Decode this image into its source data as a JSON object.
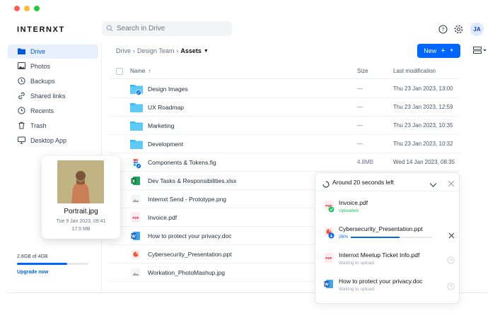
{
  "colors": {
    "accent": "#0066ff",
    "folder": "#38bdf8",
    "pdf_red": "#e11d48",
    "success": "#22c55e"
  },
  "window_dots": [
    "#ff5f57",
    "#febc2e",
    "#28c840"
  ],
  "app": {
    "logo": "INTERNXT",
    "avatar_initials": "JA"
  },
  "search": {
    "placeholder": "Search in Drive"
  },
  "sidebar": {
    "items": [
      {
        "label": "Drive",
        "icon": "folder-icon"
      },
      {
        "label": "Photos",
        "icon": "image-icon"
      },
      {
        "label": "Backups",
        "icon": "clock-backup-icon"
      },
      {
        "label": "Shared links",
        "icon": "link-icon"
      },
      {
        "label": "Recents",
        "icon": "clock-icon"
      },
      {
        "label": "Trash",
        "icon": "trash-icon"
      },
      {
        "label": "Desktop App",
        "icon": "monitor-icon"
      }
    ],
    "storage_text": "2.8GB of 4GB",
    "storage_fraction": 0.7,
    "upgrade_label": "Upgrade now"
  },
  "breadcrumb": {
    "root": "Drive",
    "parent": "Design Team",
    "current": "Assets"
  },
  "toolbar": {
    "new_label": "New",
    "new_plus": "+"
  },
  "table": {
    "headers": {
      "name": "Name",
      "size": "Size",
      "modified": "Last modification"
    },
    "rows": [
      {
        "name": "Design Images",
        "type": "folder",
        "shared": true,
        "size": "—",
        "modified": "Thu 23 Jan 2023, 13:00"
      },
      {
        "name": "UX Roadmap",
        "type": "folder",
        "shared": false,
        "size": "—",
        "modified": "Thu 23 Jan 2023, 12:59"
      },
      {
        "name": "Marketing",
        "type": "folder",
        "shared": false,
        "size": "—",
        "modified": "Thu 23 Jan 2023, 10:35"
      },
      {
        "name": "Development",
        "type": "folder",
        "shared": false,
        "size": "—",
        "modified": "Thu 23 Jan 2023, 10:32"
      },
      {
        "name": "Components & Tokens.fig",
        "type": "figma",
        "shared": true,
        "size": "4.8MB",
        "modified": "Wed 14 Jan 2023, 08:35"
      },
      {
        "name": "Dev Tasks & Responsibilities.xlsx",
        "type": "excel",
        "shared": false,
        "size": "",
        "modified": ""
      },
      {
        "name": "Internxt Send - Prototype.png",
        "type": "image",
        "shared": false,
        "size": "",
        "modified": ""
      },
      {
        "name": "Invoice.pdf",
        "type": "pdf",
        "shared": false,
        "size": "",
        "modified": ""
      },
      {
        "name": "How to protect your privacy.doc",
        "type": "word",
        "shared": false,
        "size": "",
        "modified": ""
      },
      {
        "name": "Cybersecurity_Presentation.ppt",
        "type": "ppt",
        "shared": false,
        "size": "",
        "modified": ""
      },
      {
        "name": "Workation_PhotoMashup.jpg",
        "type": "image",
        "shared": false,
        "size": "",
        "modified": ""
      }
    ]
  },
  "preview": {
    "title": "Portrait.jpg",
    "date": "Tue 9 Jan 2023, 09:41",
    "size": "17.5 MB"
  },
  "uploads": {
    "header": "Around 20 seconds left",
    "items": [
      {
        "name": "Invoice.pdf",
        "status": "Uploaded",
        "type": "pdf",
        "state": "done",
        "progress": 1.0
      },
      {
        "name": "Cybersecurity_Presentation.ppt",
        "status": "26%",
        "type": "ppt",
        "state": "uploading",
        "progress": 0.26
      },
      {
        "name": "Internxt Meetup Ticket Info.pdf",
        "status": "Waiting to upload",
        "type": "pdf",
        "state": "waiting",
        "progress": 0
      },
      {
        "name": "How to protect your privacy.doc",
        "status": "Waiting to upload",
        "type": "word",
        "state": "waiting",
        "progress": 0
      }
    ]
  }
}
